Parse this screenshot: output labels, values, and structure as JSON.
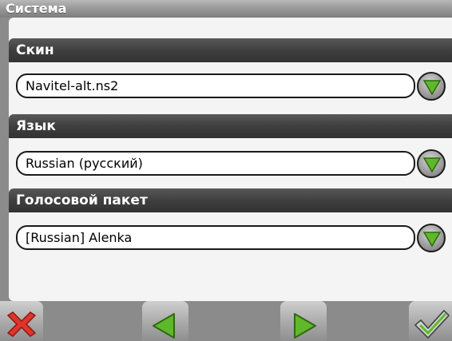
{
  "title": "Система",
  "sections": [
    {
      "header": "Скин",
      "value": "Navitel-alt.ns2"
    },
    {
      "header": "Язык",
      "value": "Russian (русский)"
    },
    {
      "header": "Голосовой пакет",
      "value": "[Russian] Alenka"
    }
  ],
  "toolbar": {
    "buttons": [
      "close-icon",
      "back-arrow-icon",
      "forward-arrow-icon",
      "checkmark-icon"
    ]
  },
  "colors": {
    "accent_green": "#5fb82a",
    "close_red": "#e0342a",
    "header_dark": "#3f3f3f"
  }
}
